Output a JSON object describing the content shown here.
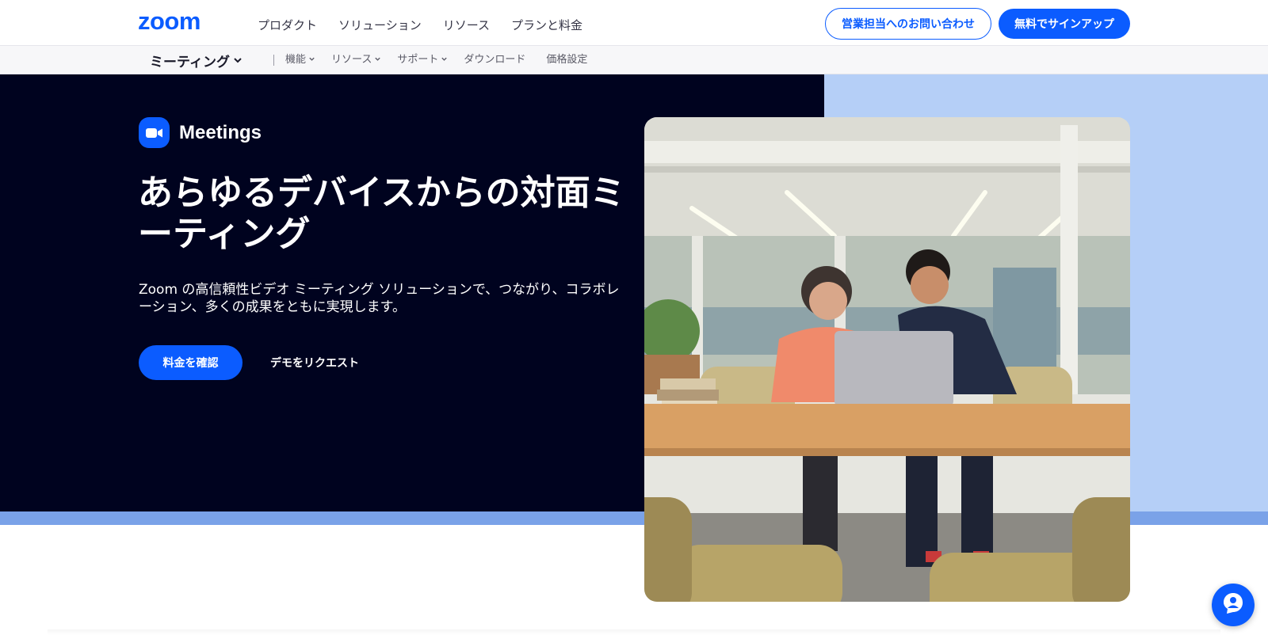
{
  "brand": {
    "logo_text": "zoom",
    "primary_color": "#0b5cff",
    "hero_dark_color": "#00031f",
    "hero_light_color": "#b5cff7"
  },
  "topnav": {
    "links": [
      "プロダクト",
      "ソリューション",
      "リソース",
      "プランと料金"
    ],
    "contact_label": "営業担当へのお問い合わせ",
    "signup_label": "無料でサインアップ"
  },
  "subnav": {
    "title": "ミーティング",
    "links": [
      {
        "label": "機能",
        "has_dropdown": true
      },
      {
        "label": "リソース",
        "has_dropdown": true
      },
      {
        "label": "サポート",
        "has_dropdown": true
      },
      {
        "label": "ダウンロード",
        "has_dropdown": false
      },
      {
        "label": "価格設定",
        "has_dropdown": false
      }
    ]
  },
  "hero": {
    "product_icon": "video-camera-icon",
    "product_name": "Meetings",
    "title": "あらゆるデバイスからの対面ミーティング",
    "description": "Zoom の高信頼性ビデオ ミーティング ソリューションで、つながり、コラボレーション、多くの成果をともに実現します。",
    "primary_cta": "料金を確認",
    "secondary_cta": "デモをリクエスト"
  },
  "chat": {
    "icon": "chat-agent-icon"
  }
}
